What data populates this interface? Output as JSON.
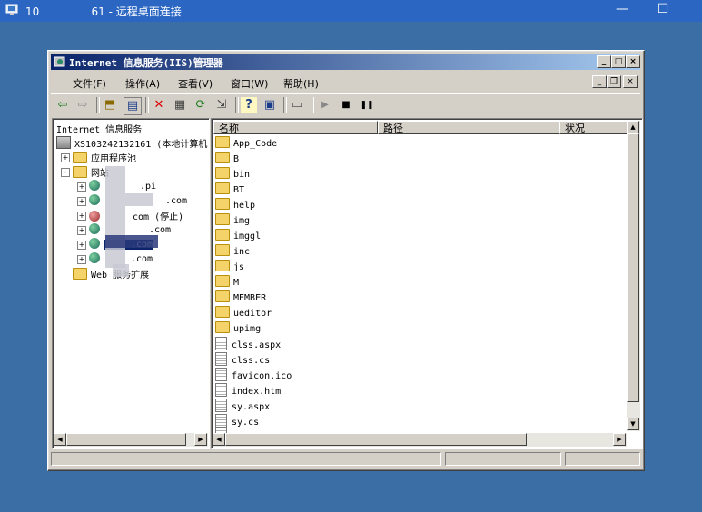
{
  "rdp": {
    "title": "10               61 - 远程桌面连接",
    "minimize": "—",
    "restore": "☐"
  },
  "window": {
    "title": "Internet 信息服务(IIS)管理器",
    "min": "_",
    "max": "□",
    "close": "×"
  },
  "menu": {
    "items": [
      "文件(F)",
      "操作(A)",
      "查看(V)",
      "窗口(W)",
      "帮助(H)"
    ],
    "mdi_min": "_",
    "mdi_restore": "❐",
    "mdi_close": "×"
  },
  "toolbar": {
    "back": "⇦",
    "forward": "⇨",
    "up": "⬒",
    "show_tree": "▤",
    "delete": "✕",
    "properties": "▦",
    "refresh": "⟳",
    "export": "⇲",
    "help": "?",
    "show_pane": "▣",
    "computer": "▭",
    "play": "▶",
    "stop": "■",
    "pause": "❚❚"
  },
  "tree": {
    "root": "Internet 信息服务",
    "server": "XS103242132161 (本地计算机",
    "app_pools": "应用程序池",
    "sites": "网站",
    "site_items": [
      ".pi",
      ".com",
      "com (停止)",
      ".com",
      ".com",
      ".com"
    ],
    "web_ext": "Web 服务扩展",
    "expand_plus": "+",
    "expand_minus": "-"
  },
  "list": {
    "headers": [
      "名称",
      "路径",
      "状况"
    ],
    "folders": [
      "App_Code",
      "B",
      "bin",
      "BT",
      "help",
      "img",
      "imggl",
      "inc",
      "js",
      "M",
      "MEMBER",
      "ueditor",
      "upimg"
    ],
    "files": [
      "clss.aspx",
      "clss.cs",
      "favicon.ico",
      "index.htm",
      "sy.aspx",
      "sy.cs"
    ],
    "partial_row": "......"
  },
  "scroll": {
    "up": "▲",
    "down": "▼",
    "left": "◀",
    "right": "▶"
  },
  "colors": {
    "desktop": "#3a6ea5",
    "titlebar_start": "#0a246a",
    "titlebar_end": "#a6caf0",
    "rdp_bar": "#2b66c2"
  }
}
